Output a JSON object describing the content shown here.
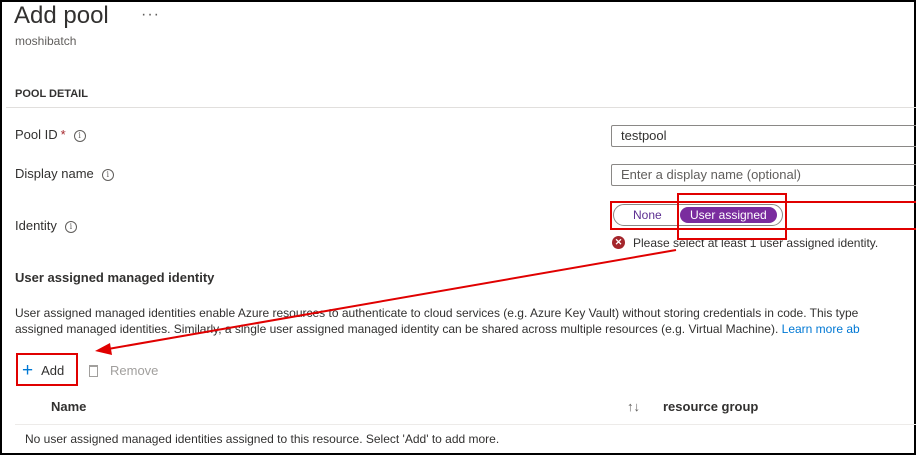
{
  "header": {
    "title": "Add pool",
    "more_label": "···",
    "subtitle": "moshibatch"
  },
  "section": {
    "title": "POOL DETAIL"
  },
  "fields": {
    "pool_id": {
      "label": "Pool ID",
      "required_mark": "*",
      "value": "testpool"
    },
    "display_name": {
      "label": "Display name",
      "placeholder": "Enter a display name (optional)"
    },
    "identity": {
      "label": "Identity",
      "options": [
        "None",
        "User assigned"
      ],
      "selected": "User assigned",
      "error": "Please select at least 1 user assigned identity."
    }
  },
  "managed_identity": {
    "heading": "User assigned managed identity",
    "description_line1": "User assigned managed identities enable Azure resources to authenticate to cloud services (e.g. Azure Key Vault) without storing credentials in code. This type",
    "description_line2": "assigned managed identities. Similarly, a single user assigned managed identity can be shared across multiple resources (e.g. Virtual Machine).",
    "learn_more": "Learn more ab",
    "toolbar": {
      "add_label": "Add",
      "remove_label": "Remove"
    },
    "table": {
      "columns": [
        "Name",
        "resource group"
      ],
      "sort_icon": "↑↓",
      "empty_message": "No user assigned managed identities assigned to this resource. Select 'Add' to add more."
    }
  },
  "colors": {
    "accent": "#0078d4",
    "toggle_selected": "#7a2c9e",
    "error": "#a4262c",
    "annotation": "#e00000"
  },
  "icons": [
    "more-icon",
    "info-icon",
    "error-icon",
    "plus-icon",
    "trash-icon",
    "sort-icon"
  ]
}
